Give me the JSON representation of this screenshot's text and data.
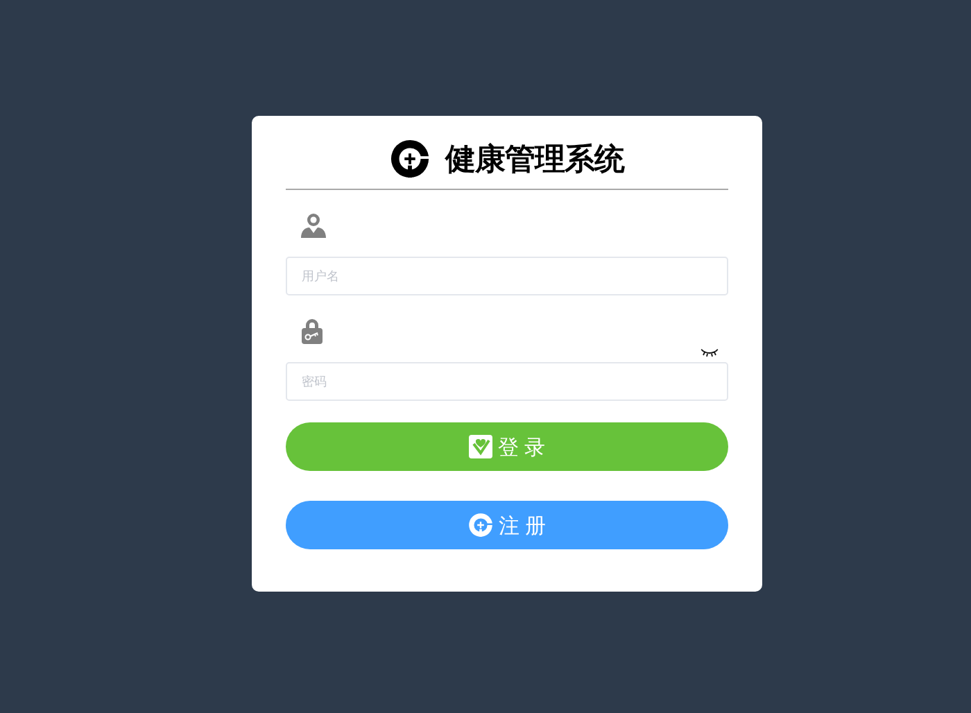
{
  "title": "健康管理系统",
  "fields": [
    {
      "kind": "username",
      "placeholder": "用户名"
    },
    {
      "kind": "password",
      "placeholder": "密码"
    }
  ],
  "buttons": [
    {
      "kind": "login",
      "label": "登 录"
    },
    {
      "kind": "register",
      "label": "注 册"
    }
  ]
}
